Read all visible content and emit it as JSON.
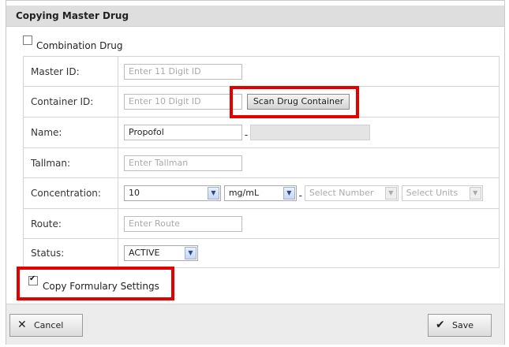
{
  "dialog": {
    "title": "Copying Master Drug",
    "combination_label": "Combination Drug",
    "combination_checked": false,
    "fields": {
      "master_id": {
        "label": "Master ID:",
        "placeholder": "Enter 11 Digit ID"
      },
      "container_id": {
        "label": "Container ID:",
        "placeholder": "Enter 10 Digit ID",
        "scan_button": "Scan Drug Container"
      },
      "name": {
        "label": "Name:",
        "value": "Propofol",
        "separator": "-"
      },
      "tallman": {
        "label": "Tallman:",
        "placeholder": "Enter Tallman"
      },
      "concentration": {
        "label": "Concentration:",
        "number": "10",
        "units": "mg/mL",
        "separator": "-",
        "number2_placeholder": "Select Number",
        "units2_placeholder": "Select Units"
      },
      "route": {
        "label": "Route:",
        "placeholder": "Enter Route"
      },
      "status": {
        "label": "Status:",
        "value": "ACTIVE"
      }
    },
    "copy_formulary_label": "Copy Formulary Settings",
    "copy_formulary_checked": true,
    "footer": {
      "cancel_label": "Cancel",
      "save_label": "Save"
    },
    "highlight_color": "#e30000"
  }
}
